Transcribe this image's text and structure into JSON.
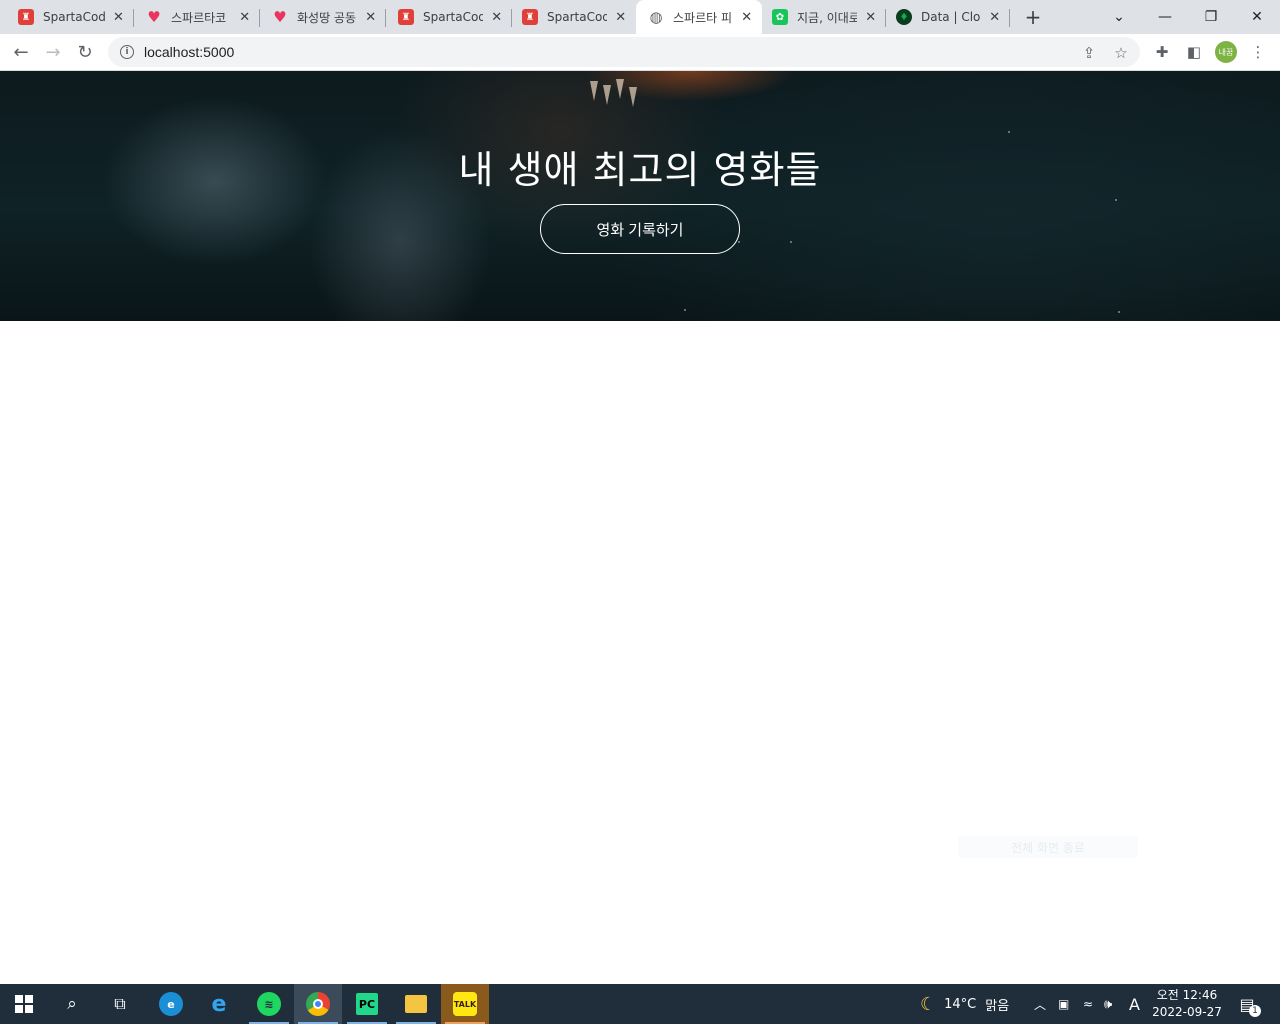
{
  "browser": {
    "tabs": [
      {
        "title": "SpartaCodi",
        "favicon": "sparta-icon",
        "color": "#e0403a",
        "active": false
      },
      {
        "title": "스파르타코",
        "favicon": "heart-icon",
        "color": "#e8345e",
        "active": false
      },
      {
        "title": "화성땅 공동",
        "favicon": "heart-icon",
        "color": "#e8345e",
        "active": false
      },
      {
        "title": "SpartaCodi",
        "favicon": "sparta-icon",
        "color": "#e0403a",
        "active": false
      },
      {
        "title": "SpartaCodi",
        "favicon": "sparta-icon",
        "color": "#e0403a",
        "active": false
      },
      {
        "title": "스파르타 피",
        "favicon": "globe-icon",
        "color": "#5f6368",
        "active": true
      },
      {
        "title": "지금, 이대로",
        "favicon": "app-icon",
        "color": "#19c45a",
        "active": false
      },
      {
        "title": "Data | Clou",
        "favicon": "leaf-icon",
        "color": "#0a3d1e",
        "active": false
      }
    ],
    "address_bar": {
      "url": "localhost:5000"
    },
    "profile_label": "내꿈"
  },
  "page": {
    "hero_title": "내 생애 최고의 영화들",
    "record_button_label": "영화 기록하기",
    "ghost_note": "전체 화면 종료"
  },
  "taskbar": {
    "weather": {
      "temp": "14°C",
      "condition": "맑음"
    },
    "ime": "A",
    "clock": {
      "ampm_time": "오전 12:46",
      "date": "2022-09-27"
    },
    "notification_count": "1"
  },
  "colors": {
    "tab_strip": "#dee1e6",
    "taskbar": "#1f2e3a",
    "hero_text": "#ffffff"
  }
}
